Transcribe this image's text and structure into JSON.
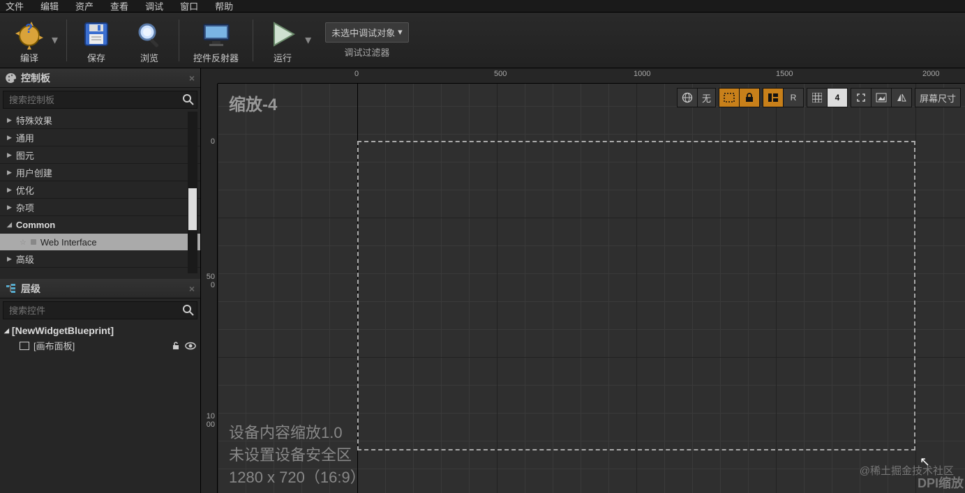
{
  "menu": {
    "file": "文件",
    "edit": "编辑",
    "asset": "资产",
    "view": "查看",
    "debug": "调试",
    "window": "窗口",
    "help": "帮助"
  },
  "toolbar": {
    "compile": "编译",
    "save": "保存",
    "browse": "浏览",
    "reflector": "控件反射器",
    "play": "运行",
    "debug_sel": "未选中调试对象",
    "debug_filter": "调试过滤器"
  },
  "palette": {
    "title": "控制板",
    "search_ph": "搜索控制板",
    "items": [
      "特殊效果",
      "通用",
      "图元",
      "用户创建",
      "优化",
      "杂项"
    ],
    "common": "Common",
    "web_item": "Web Interface",
    "advanced": "高级"
  },
  "hierarchy": {
    "title": "层级",
    "search_ph": "搜索控件",
    "root": "[NewWidgetBlueprint]",
    "child": "[画布面板]"
  },
  "viewport": {
    "zoom": "缩放-4",
    "ruler_h": [
      "0",
      "500",
      "1000",
      "1500",
      "2000"
    ],
    "ruler_v": [
      "0",
      "500",
      "1000"
    ],
    "none": "无",
    "r": "R",
    "num": "4",
    "screen": "屏幕尺寸",
    "info1": "设备内容缩放1.0",
    "info2": "未设置设备安全区",
    "info3": "1280 x 720（16:9）",
    "watermark": "@稀土掘金技术社区",
    "dpi": "DPI缩放"
  }
}
